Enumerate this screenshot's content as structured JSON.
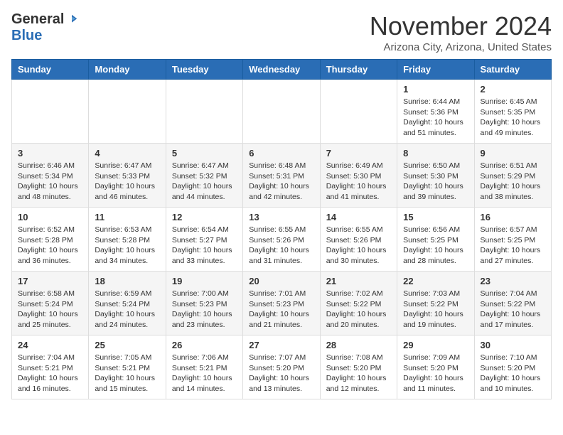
{
  "logo": {
    "general": "General",
    "blue": "Blue"
  },
  "title": "November 2024",
  "location": "Arizona City, Arizona, United States",
  "days_of_week": [
    "Sunday",
    "Monday",
    "Tuesday",
    "Wednesday",
    "Thursday",
    "Friday",
    "Saturday"
  ],
  "weeks": [
    [
      {
        "day": "",
        "info": ""
      },
      {
        "day": "",
        "info": ""
      },
      {
        "day": "",
        "info": ""
      },
      {
        "day": "",
        "info": ""
      },
      {
        "day": "",
        "info": ""
      },
      {
        "day": "1",
        "info": "Sunrise: 6:44 AM\nSunset: 5:36 PM\nDaylight: 10 hours and 51 minutes."
      },
      {
        "day": "2",
        "info": "Sunrise: 6:45 AM\nSunset: 5:35 PM\nDaylight: 10 hours and 49 minutes."
      }
    ],
    [
      {
        "day": "3",
        "info": "Sunrise: 6:46 AM\nSunset: 5:34 PM\nDaylight: 10 hours and 48 minutes."
      },
      {
        "day": "4",
        "info": "Sunrise: 6:47 AM\nSunset: 5:33 PM\nDaylight: 10 hours and 46 minutes."
      },
      {
        "day": "5",
        "info": "Sunrise: 6:47 AM\nSunset: 5:32 PM\nDaylight: 10 hours and 44 minutes."
      },
      {
        "day": "6",
        "info": "Sunrise: 6:48 AM\nSunset: 5:31 PM\nDaylight: 10 hours and 42 minutes."
      },
      {
        "day": "7",
        "info": "Sunrise: 6:49 AM\nSunset: 5:30 PM\nDaylight: 10 hours and 41 minutes."
      },
      {
        "day": "8",
        "info": "Sunrise: 6:50 AM\nSunset: 5:30 PM\nDaylight: 10 hours and 39 minutes."
      },
      {
        "day": "9",
        "info": "Sunrise: 6:51 AM\nSunset: 5:29 PM\nDaylight: 10 hours and 38 minutes."
      }
    ],
    [
      {
        "day": "10",
        "info": "Sunrise: 6:52 AM\nSunset: 5:28 PM\nDaylight: 10 hours and 36 minutes."
      },
      {
        "day": "11",
        "info": "Sunrise: 6:53 AM\nSunset: 5:28 PM\nDaylight: 10 hours and 34 minutes."
      },
      {
        "day": "12",
        "info": "Sunrise: 6:54 AM\nSunset: 5:27 PM\nDaylight: 10 hours and 33 minutes."
      },
      {
        "day": "13",
        "info": "Sunrise: 6:55 AM\nSunset: 5:26 PM\nDaylight: 10 hours and 31 minutes."
      },
      {
        "day": "14",
        "info": "Sunrise: 6:55 AM\nSunset: 5:26 PM\nDaylight: 10 hours and 30 minutes."
      },
      {
        "day": "15",
        "info": "Sunrise: 6:56 AM\nSunset: 5:25 PM\nDaylight: 10 hours and 28 minutes."
      },
      {
        "day": "16",
        "info": "Sunrise: 6:57 AM\nSunset: 5:25 PM\nDaylight: 10 hours and 27 minutes."
      }
    ],
    [
      {
        "day": "17",
        "info": "Sunrise: 6:58 AM\nSunset: 5:24 PM\nDaylight: 10 hours and 25 minutes."
      },
      {
        "day": "18",
        "info": "Sunrise: 6:59 AM\nSunset: 5:24 PM\nDaylight: 10 hours and 24 minutes."
      },
      {
        "day": "19",
        "info": "Sunrise: 7:00 AM\nSunset: 5:23 PM\nDaylight: 10 hours and 23 minutes."
      },
      {
        "day": "20",
        "info": "Sunrise: 7:01 AM\nSunset: 5:23 PM\nDaylight: 10 hours and 21 minutes."
      },
      {
        "day": "21",
        "info": "Sunrise: 7:02 AM\nSunset: 5:22 PM\nDaylight: 10 hours and 20 minutes."
      },
      {
        "day": "22",
        "info": "Sunrise: 7:03 AM\nSunset: 5:22 PM\nDaylight: 10 hours and 19 minutes."
      },
      {
        "day": "23",
        "info": "Sunrise: 7:04 AM\nSunset: 5:22 PM\nDaylight: 10 hours and 17 minutes."
      }
    ],
    [
      {
        "day": "24",
        "info": "Sunrise: 7:04 AM\nSunset: 5:21 PM\nDaylight: 10 hours and 16 minutes."
      },
      {
        "day": "25",
        "info": "Sunrise: 7:05 AM\nSunset: 5:21 PM\nDaylight: 10 hours and 15 minutes."
      },
      {
        "day": "26",
        "info": "Sunrise: 7:06 AM\nSunset: 5:21 PM\nDaylight: 10 hours and 14 minutes."
      },
      {
        "day": "27",
        "info": "Sunrise: 7:07 AM\nSunset: 5:20 PM\nDaylight: 10 hours and 13 minutes."
      },
      {
        "day": "28",
        "info": "Sunrise: 7:08 AM\nSunset: 5:20 PM\nDaylight: 10 hours and 12 minutes."
      },
      {
        "day": "29",
        "info": "Sunrise: 7:09 AM\nSunset: 5:20 PM\nDaylight: 10 hours and 11 minutes."
      },
      {
        "day": "30",
        "info": "Sunrise: 7:10 AM\nSunset: 5:20 PM\nDaylight: 10 hours and 10 minutes."
      }
    ]
  ]
}
